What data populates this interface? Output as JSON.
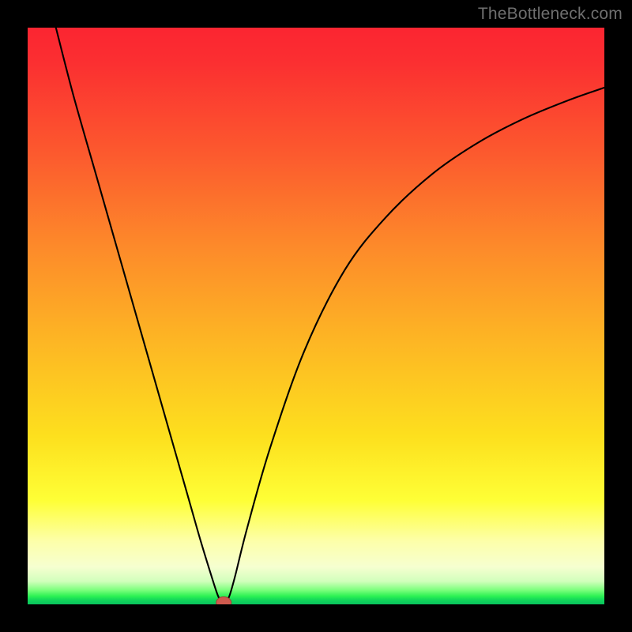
{
  "watermark": "TheBottleneck.com",
  "colors": {
    "page_bg": "#000000",
    "curve_stroke": "#000000",
    "marker_fill": "#cf5a4e",
    "marker_stroke": "#a63f35",
    "gradient_top": "#fb2531",
    "gradient_bottom": "#08c35e"
  },
  "chart_data": {
    "type": "line",
    "title": "",
    "xlabel": "",
    "ylabel": "",
    "xlim": [
      0,
      100
    ],
    "ylim": [
      0,
      100
    ],
    "grid": false,
    "legend": null,
    "annotations": [],
    "series": [
      {
        "name": "curve",
        "x": [
          4.9,
          8,
          12,
          16,
          20,
          24,
          28,
          30,
          32,
          33,
          33.7,
          34.3,
          35,
          36,
          38,
          42,
          48,
          55,
          62,
          70,
          78,
          86,
          94,
          100
        ],
        "y": [
          100,
          88,
          74,
          60,
          46,
          32,
          18,
          11,
          4.5,
          1.5,
          0.3,
          0.3,
          1.5,
          5,
          13,
          27,
          44,
          58,
          67,
          74.5,
          80,
          84.2,
          87.5,
          89.6
        ]
      }
    ],
    "marker": {
      "x": 34,
      "y": 0.3,
      "rx": 1.3,
      "ry": 1.0
    }
  }
}
